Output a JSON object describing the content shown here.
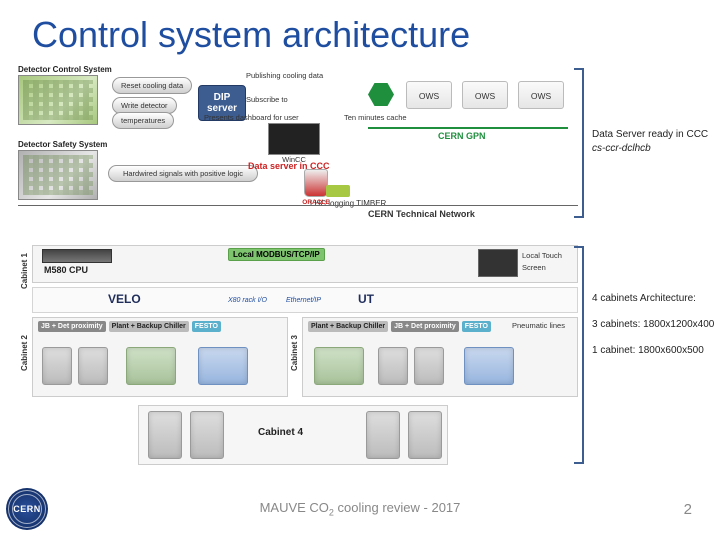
{
  "title": "Control system architecture",
  "upper": {
    "dcs_label": "Detector Control System",
    "dss_label": "Detector Safety System",
    "dip_line1": "DIP",
    "dip_line2": "server",
    "btn_reset": "Reset cooling data",
    "btn_writedetector": "Write detector",
    "btn_temperatures": "temperatures",
    "pub_label": "Publishing cooling data",
    "sub_label": "Subscribe to",
    "dash_label": "Presents dashboard for user",
    "hw_label": "Hardwired signals with positive logic",
    "wincc": "WinCC",
    "data_server": "Data server in CCC",
    "ten_min_cache": "Ten minutes cache",
    "lhc_logging": "LHC logging TIMBER",
    "ows1": "OWS",
    "ows2": "OWS",
    "ows3": "OWS",
    "gpn_label": "CERN GPN",
    "ctn_label": "CERN Technical Network"
  },
  "annotations": {
    "top_line1": "Data Server ready in CCC",
    "top_line2": "cs-ccr-dclhcb",
    "mid_line1": "4 cabinets Architecture:",
    "mid_line2": "3 cabinets: 1800x1200x400",
    "mid_line3": "1 cabinet: 1800x600x500"
  },
  "lower": {
    "cab1": "Cabinet 1",
    "cab2": "Cabinet 2",
    "cab3": "Cabinet 3",
    "cab4": "Cabinet 4",
    "cpu": "M580 CPU",
    "modbus": "Local MODBUS/TCP/IP",
    "touch": "Local Touch",
    "screen": "Screen",
    "velo": "VELO",
    "ut": "UT",
    "x80rackm": "X80 rack I/O",
    "ethernetip": "Ethernet/IP",
    "jb_det": "JB + Det proximity",
    "plant_chill": "Plant + Backup Chiller",
    "festo": "FESTO",
    "pneum": "Pneumatic lines"
  },
  "footer": {
    "org": "CERN",
    "center_a": "MAUVE CO",
    "center_sub": "2",
    "center_b": " cooling review - 2017",
    "page": "2"
  }
}
